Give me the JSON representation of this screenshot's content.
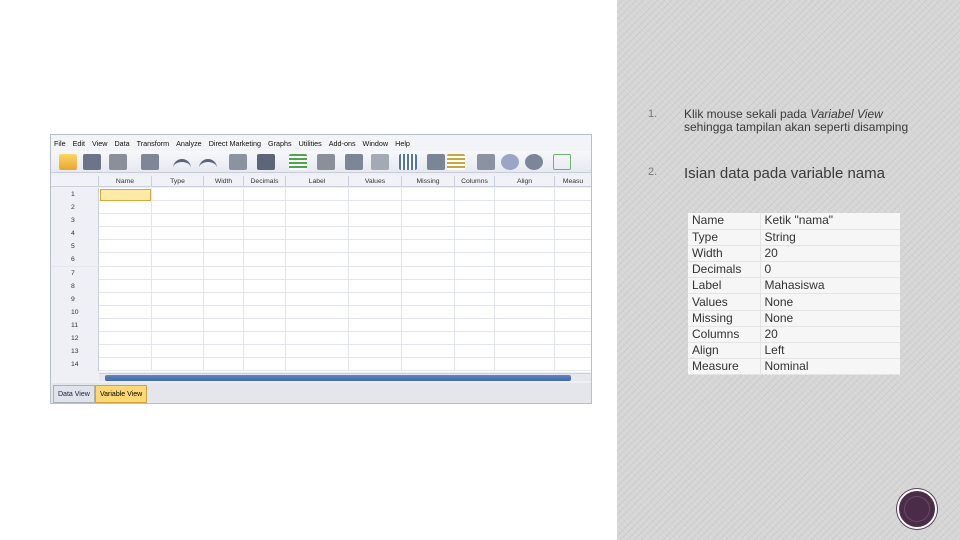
{
  "steps": [
    {
      "num": "1.",
      "text_plain": "Klik mouse sekali pada ",
      "text_italic": "Variabel View",
      "text_rest": " sehingga tampilan akan seperti disamping"
    },
    {
      "num": "2.",
      "text": "Isian data pada variable nama"
    }
  ],
  "properties": [
    {
      "key": "Name",
      "value": "Ketik \"nama\""
    },
    {
      "key": "Type",
      "value": "String"
    },
    {
      "key": "Width",
      "value": "20"
    },
    {
      "key": "Decimals",
      "value": "0"
    },
    {
      "key": "Label",
      "value": "Mahasiswa"
    },
    {
      "key": "Values",
      "value": "None"
    },
    {
      "key": "Missing",
      "value": "None"
    },
    {
      "key": "Columns",
      "value": "20"
    },
    {
      "key": "Align",
      "value": "Left"
    },
    {
      "key": "Measure",
      "value": "Nominal"
    }
  ],
  "spss": {
    "menu": [
      "File",
      "Edit",
      "View",
      "Data",
      "Transform",
      "Analyze",
      "Direct Marketing",
      "Graphs",
      "Utilities",
      "Add-ons",
      "Window",
      "Help"
    ],
    "columns": [
      "Name",
      "Type",
      "Width",
      "Decimals",
      "Label",
      "Values",
      "Missing",
      "Columns",
      "Align",
      "Measu"
    ],
    "rows": [
      "1",
      "2",
      "3",
      "4",
      "5",
      "6",
      "7",
      "8",
      "9",
      "10",
      "11",
      "12",
      "13",
      "14"
    ],
    "tabs": {
      "data_view": "Data View",
      "variable_view": "Variable View"
    },
    "active_tab": "Variable View",
    "selection_color": "#ffe9a6"
  },
  "colors": {
    "panel": "#d6d6d6",
    "nav_circle": "#4a2e47"
  }
}
